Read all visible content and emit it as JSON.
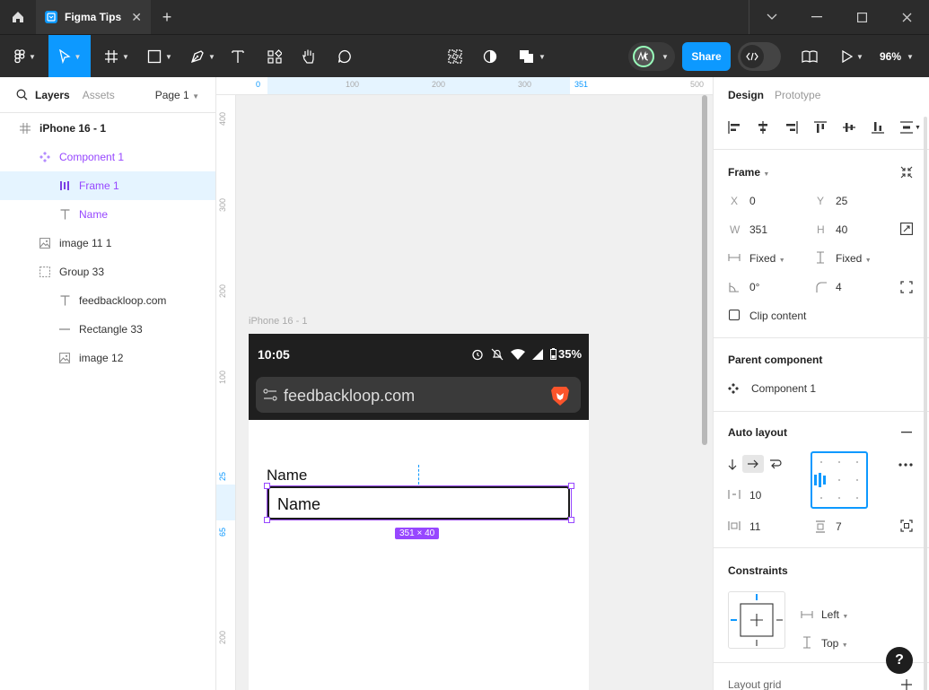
{
  "titlebar": {
    "tab_title": "Figma Tips",
    "close_glyph": "✕",
    "plus_glyph": "+"
  },
  "toolbar": {
    "share_label": "Share",
    "zoom_label": "96%"
  },
  "layers_panel": {
    "tab_layers": "Layers",
    "tab_assets": "Assets",
    "page_selector": "Page 1",
    "items": [
      {
        "label": "iPhone 16 - 1",
        "icon": "frame-icon"
      },
      {
        "label": "Component 1",
        "icon": "component-icon"
      },
      {
        "label": "Frame 1",
        "icon": "auto-layout-icon"
      },
      {
        "label": "Name",
        "icon": "text-icon"
      },
      {
        "label": "image 11 1",
        "icon": "image-icon"
      },
      {
        "label": "Group 33",
        "icon": "group-icon"
      },
      {
        "label": "feedbackloop.com",
        "icon": "text-icon"
      },
      {
        "label": "Rectangle 33",
        "icon": "line-icon"
      },
      {
        "label": "image 12",
        "icon": "image-icon"
      }
    ]
  },
  "rulers": {
    "top": [
      "0",
      "100",
      "200",
      "300",
      "351",
      "500"
    ],
    "left": [
      "400",
      "300",
      "200",
      "100",
      "25",
      "65",
      "200"
    ]
  },
  "canvas": {
    "frame_label": "iPhone 16 - 1",
    "status_time": "10:05",
    "battery": "35%",
    "url": "feedbackloop.com",
    "field_label": "Name",
    "field_value": "Name",
    "size_badge": "351 × 40"
  },
  "design_panel": {
    "tab_design": "Design",
    "tab_prototype": "Prototype",
    "frame_title": "Frame",
    "x_label": "X",
    "x_value": "0",
    "y_label": "Y",
    "y_value": "25",
    "w_label": "W",
    "w_value": "351",
    "h_label": "H",
    "h_value": "40",
    "horizontal_sizing": "Fixed",
    "vertical_sizing": "Fixed",
    "rotation": "0°",
    "corner_radius": "4",
    "clip_content": "Clip content",
    "parent_component_title": "Parent component",
    "parent_component_name": "Component 1",
    "auto_layout_title": "Auto layout",
    "gap_value": "10",
    "horizontal_padding": "11",
    "vertical_padding": "7",
    "constraints_title": "Constraints",
    "constraint_horizontal": "Left",
    "constraint_vertical": "Top",
    "layout_grid_title": "Layout grid"
  },
  "help_label": "?",
  "colors": {
    "accent": "#0d99ff",
    "component": "#9747ff",
    "dark": "#2c2c2c"
  }
}
